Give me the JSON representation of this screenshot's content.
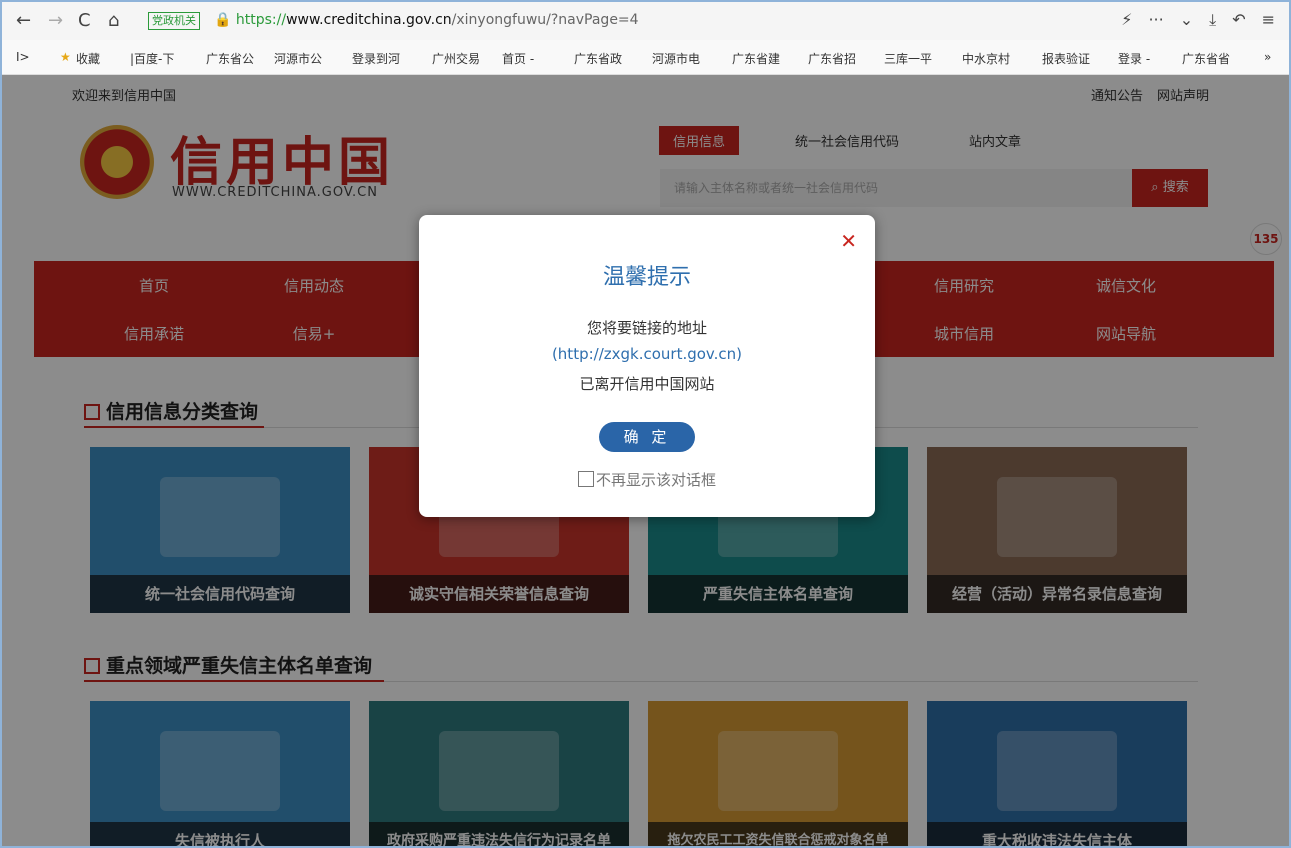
{
  "browser": {
    "badge": "党政机关",
    "url_scheme": "https://",
    "url_host": "www.creditchina.gov.cn",
    "url_path": "/xinyongfuwu/?navPage=4",
    "bookmarks": [
      "收藏",
      "|百度-下",
      "广东省公",
      "河源市公",
      "登录到河",
      "广州交易",
      "首页 -",
      "广东省政",
      "河源市电",
      "广东省建",
      "广东省招",
      "三库一平",
      "中水京村",
      "报表验证",
      "登录 -",
      "广东省省"
    ],
    "overflow": "»"
  },
  "site": {
    "welcome": "欢迎来到信用中国",
    "top_links": [
      "通知公告",
      "网站声明"
    ],
    "logo_title": "信用中国",
    "logo_sub": "WWW.CREDITCHINA.GOV.CN",
    "search_tabs": [
      "信用信息",
      "统一社会信用代码",
      "站内文章"
    ],
    "search_placeholder": "请输入主体名称或者统一社会信用代码",
    "search_button": "搜索",
    "side_badge": "135",
    "menu_row1": [
      "首页",
      "信用动态",
      "信用研究",
      "诚信文化"
    ],
    "menu_row2": [
      "信用承诺",
      "信易+",
      "城市信用",
      "网站导航"
    ],
    "section1_title": "信用信息分类查询",
    "cards1": [
      "统一社会信用代码查询",
      "诚实守信相关荣誉信息查询",
      "严重失信主体名单查询",
      "经营（活动）异常名录信息查询"
    ],
    "section2_title": "重点领域严重失信主体名单查询",
    "cards2": [
      "失信被执行人",
      "政府采购严重违法失信行为记录名单",
      "拖欠农民工工资失信联合惩戒对象名单",
      "重大税收违法失信主体"
    ]
  },
  "modal": {
    "title": "温馨提示",
    "line1": "您将要链接的地址",
    "link": "(http://zxgk.court.gov.cn)",
    "line3": "已离开信用中国网站",
    "ok_button": "确 定",
    "checkbox_label": "不再显示该对话框"
  },
  "colors": {
    "brand_red": "#c8251f",
    "modal_blue": "#2a65a8"
  }
}
